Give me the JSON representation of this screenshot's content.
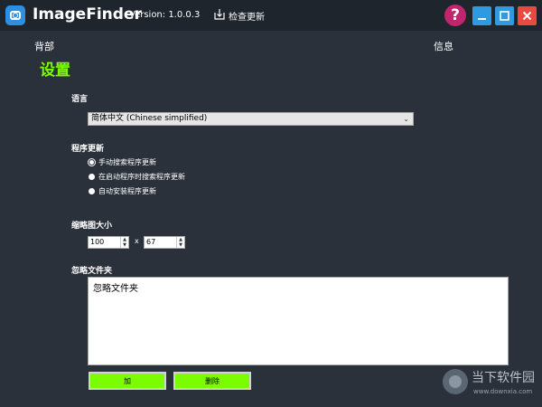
{
  "titlebar": {
    "app_name": "ImageFinder",
    "version": "Version: 1.0.0.3",
    "check_update": "检查更新",
    "help_glyph": "?"
  },
  "nav": {
    "back": "背部",
    "info": "信息"
  },
  "page": {
    "title": "设置"
  },
  "language": {
    "label": "语言",
    "selected": "简体中文 (Chinese simplified)"
  },
  "update": {
    "label": "程序更新",
    "options": [
      {
        "label": "手动搜索程序更新",
        "selected": true
      },
      {
        "label": "在启动程序时搜索程序更新",
        "selected": false
      },
      {
        "label": "自动安装程序更新",
        "selected": false
      }
    ]
  },
  "thumbnail": {
    "label": "缩略图大小",
    "width": "100",
    "separator": "x",
    "height": "67"
  },
  "ignore": {
    "label": "忽略文件夹",
    "content": "忽略文件夹",
    "add": "加",
    "delete": "删除"
  },
  "watermark": {
    "text": "当下软件园",
    "url": "www.downxia.com"
  },
  "colors": {
    "background": "#2a313b",
    "accent_green": "#7cfc00",
    "help_button": "#c0256d",
    "window_button": "#2f9ae0",
    "close_button": "#e84a3e"
  }
}
